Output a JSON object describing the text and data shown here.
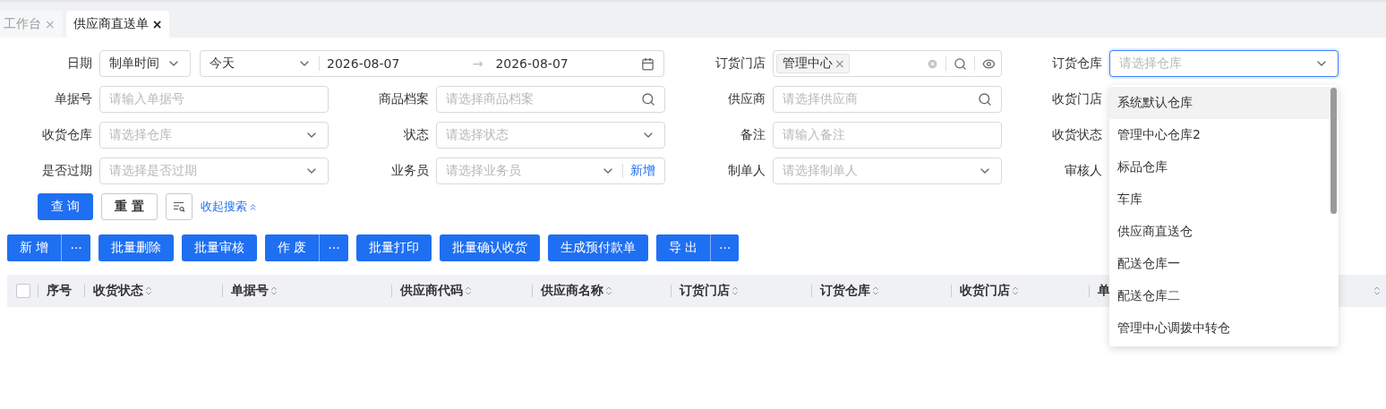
{
  "tabs": [
    {
      "label": "工作台",
      "close": "×",
      "selected": false
    },
    {
      "label": "供应商直送单",
      "close": "×",
      "selected": true
    }
  ],
  "filters": [
    {
      "kind": "date-range",
      "label": "日期",
      "type_value": "制单时间",
      "preset": "今天",
      "start": "2026-08-07",
      "separator": "→",
      "end": "2026-08-07"
    },
    {
      "kind": "tags",
      "label": "订货门店",
      "tags": [
        {
          "label": "管理中心",
          "close": "×"
        }
      ]
    },
    {
      "kind": "dropdown",
      "label": "订货仓库",
      "placeholder": "请选择仓库",
      "focused": true,
      "options": [
        {
          "label": "系统默认仓库",
          "selected": true
        },
        {
          "label": "管理中心仓库2",
          "selected": false
        },
        {
          "label": "标品仓库",
          "selected": false
        },
        {
          "label": "车库",
          "selected": false
        },
        {
          "label": "供应商直送仓",
          "selected": false
        },
        {
          "label": "配送仓库一",
          "selected": false
        },
        {
          "label": "配送仓库二",
          "selected": false
        },
        {
          "label": "管理中心调拨中转仓",
          "selected": false
        }
      ]
    },
    {
      "kind": "input",
      "label": "单据号",
      "placeholder": "请输入单据号"
    },
    {
      "kind": "search",
      "label": "商品档案",
      "placeholder": "请选择商品档案"
    },
    {
      "kind": "search",
      "label": "供应商",
      "placeholder": "请选择供应商"
    },
    {
      "kind": "covered",
      "label": "收货门店"
    },
    {
      "kind": "select",
      "label": "收货仓库",
      "placeholder": "请选择仓库"
    },
    {
      "kind": "select",
      "label": "状态",
      "placeholder": "请选择状态"
    },
    {
      "kind": "input",
      "label": "备注",
      "placeholder": "请输入备注"
    },
    {
      "kind": "covered",
      "label": "收货状态"
    },
    {
      "kind": "select",
      "label": "是否过期",
      "placeholder": "请选择是否过期"
    },
    {
      "kind": "select",
      "label": "业务员",
      "placeholder": "请选择业务员",
      "add_link": "新增"
    },
    {
      "kind": "select",
      "label": "制单人",
      "placeholder": "请选择制单人"
    },
    {
      "kind": "covered",
      "label": "审核人"
    }
  ],
  "search_actions": {
    "query": "查 询",
    "reset": "重 置",
    "collapse_link": "收起搜索"
  },
  "toolbar": [
    {
      "kind": "split",
      "label": "新 增",
      "more": "···"
    },
    {
      "kind": "plain",
      "label": "批量删除"
    },
    {
      "kind": "plain",
      "label": "批量审核"
    },
    {
      "kind": "split",
      "label": "作 废",
      "more": "···"
    },
    {
      "kind": "plain",
      "label": "批量打印"
    },
    {
      "kind": "plain",
      "label": "批量确认收货"
    },
    {
      "kind": "plain",
      "label": "生成预付款单"
    },
    {
      "kind": "split",
      "label": "导 出",
      "more": "···"
    }
  ],
  "table": {
    "select_all_checked": false,
    "columns": [
      {
        "label": "序号",
        "sortable": false
      },
      {
        "label": "收货状态",
        "sortable": true
      },
      {
        "label": "单据号",
        "sortable": true
      },
      {
        "label": "供应商代码",
        "sortable": true
      },
      {
        "label": "供应商名称",
        "sortable": true
      },
      {
        "label": "订货门店",
        "sortable": true
      },
      {
        "label": "订货仓库",
        "sortable": true
      },
      {
        "label": "收货门店",
        "sortable": true
      },
      {
        "label": "单",
        "sortable": false
      },
      {
        "sortable": true
      }
    ]
  }
}
